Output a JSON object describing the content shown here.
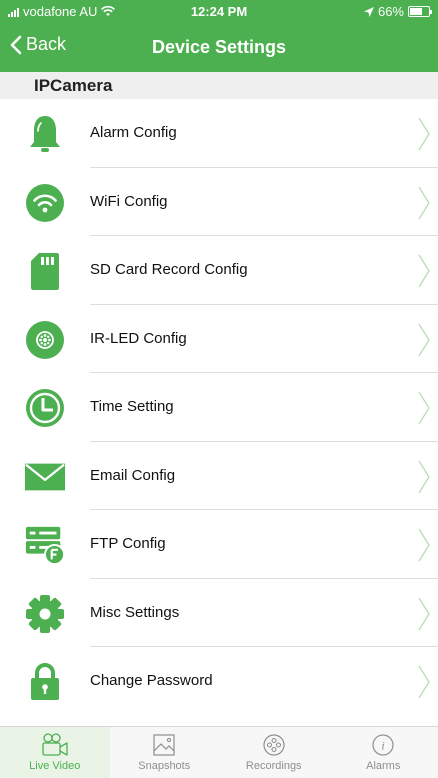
{
  "status_bar": {
    "carrier": "vodafone AU",
    "time": "12:24 PM",
    "battery": "66%",
    "battery_level": 0.66
  },
  "nav": {
    "back_label": "Back",
    "title": "Device Settings"
  },
  "section": {
    "title": "IPCamera"
  },
  "menu": {
    "items": [
      {
        "label": "Alarm Config",
        "icon": "bell-icon"
      },
      {
        "label": "WiFi Config",
        "icon": "wifi-icon"
      },
      {
        "label": "SD Card Record Config",
        "icon": "sd-card-icon"
      },
      {
        "label": "IR-LED Config",
        "icon": "ir-led-icon"
      },
      {
        "label": "Time Setting",
        "icon": "clock-icon"
      },
      {
        "label": "Email Config",
        "icon": "envelope-icon"
      },
      {
        "label": "FTP Config",
        "icon": "ftp-server-icon"
      },
      {
        "label": "Misc Settings",
        "icon": "gear-icon"
      },
      {
        "label": "Change Password",
        "icon": "lock-icon"
      }
    ]
  },
  "tabbar": {
    "tabs": [
      {
        "label": "Live Video",
        "icon": "video-camera-icon",
        "active": true
      },
      {
        "label": "Snapshots",
        "icon": "image-icon",
        "active": false
      },
      {
        "label": "Recordings",
        "icon": "film-reel-icon",
        "active": false
      },
      {
        "label": "Alarms",
        "icon": "info-icon",
        "active": false
      }
    ]
  },
  "colors": {
    "accent": "#4caf50",
    "inactive_tab": "#8e8e93",
    "section_bg": "#efefef"
  }
}
